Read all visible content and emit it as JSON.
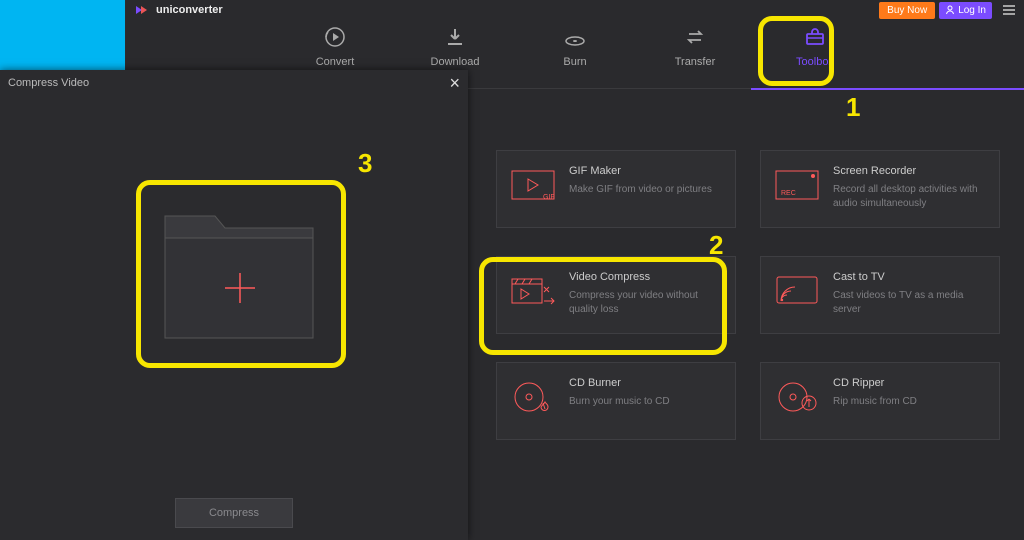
{
  "app_name": "uniconverter",
  "titlebar": {
    "buy_label": "Buy Now",
    "login_label": "Log In"
  },
  "nav": [
    {
      "key": "convert",
      "label": "Convert"
    },
    {
      "key": "download",
      "label": "Download"
    },
    {
      "key": "burn",
      "label": "Burn"
    },
    {
      "key": "transfer",
      "label": "Transfer"
    },
    {
      "key": "toolbox",
      "label": "Toolbox",
      "active": true
    }
  ],
  "cards": {
    "gif": {
      "title": "GIF Maker",
      "desc": "Make GIF from video or pictures"
    },
    "screen": {
      "title": "Screen Recorder",
      "desc": "Record all desktop activities with audio simultaneously"
    },
    "compress": {
      "title": "Video Compress",
      "desc": "Compress your video without quality loss"
    },
    "cast": {
      "title": "Cast to TV",
      "desc": "Cast videos to TV as a media server"
    },
    "burner": {
      "title": "CD Burner",
      "desc": "Burn your music to CD"
    },
    "ripper": {
      "title": "CD Ripper",
      "desc": "Rip music from CD"
    }
  },
  "panel": {
    "title": "Compress Video",
    "compress_label": "Compress"
  },
  "annotations": {
    "n1": "1",
    "n2": "2",
    "n3": "3"
  },
  "colors": {
    "accent": "#7b4cff",
    "orange": "#ff7a1a",
    "highlight": "#f7e600",
    "red": "#ff5a5a"
  }
}
